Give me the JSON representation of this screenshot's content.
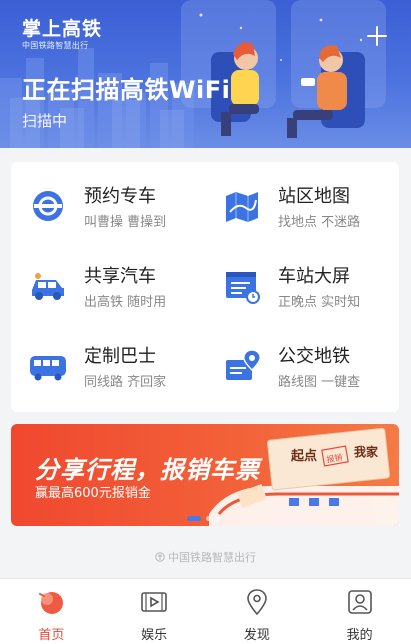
{
  "header": {
    "logo_main": "掌上高铁",
    "logo_sub": "中国铁路智慧出行",
    "scan_title": "正在扫描高铁WiFi",
    "scan_status": "扫描中",
    "accent": "#3b5fd4"
  },
  "services": [
    {
      "title": "预约专车",
      "subtitle": "叫曹操 曹操到",
      "icon": "car-service-icon"
    },
    {
      "title": "站区地图",
      "subtitle": "找地点 不迷路",
      "icon": "map-icon"
    },
    {
      "title": "共享汽车",
      "subtitle": "出高铁 随时用",
      "icon": "shared-car-icon"
    },
    {
      "title": "车站大屏",
      "subtitle": "正晚点 实时知",
      "icon": "station-screen-icon"
    },
    {
      "title": "定制巴士",
      "subtitle": "同线路 齐回家",
      "icon": "bus-icon"
    },
    {
      "title": "公交地铁",
      "subtitle": "路线图 一键查",
      "icon": "transit-icon"
    }
  ],
  "banner": {
    "title": "分享行程，报销车票",
    "subtitle": "赢最高600元报销金",
    "ticket_label_1": "起点",
    "ticket_label_2": "我家",
    "ticket_stamp": "报销",
    "active_slide": 0,
    "slides": 3
  },
  "footer": {
    "brand": "中国铁路智慧出行"
  },
  "tabs": [
    {
      "label": "首页",
      "active": true
    },
    {
      "label": "娱乐",
      "active": false
    },
    {
      "label": "发现",
      "active": false
    },
    {
      "label": "我的",
      "active": false
    }
  ],
  "colors": {
    "icon_blue": "#3c73e3",
    "tab_active": "#e8493b",
    "banner_red": "#f0482f"
  }
}
